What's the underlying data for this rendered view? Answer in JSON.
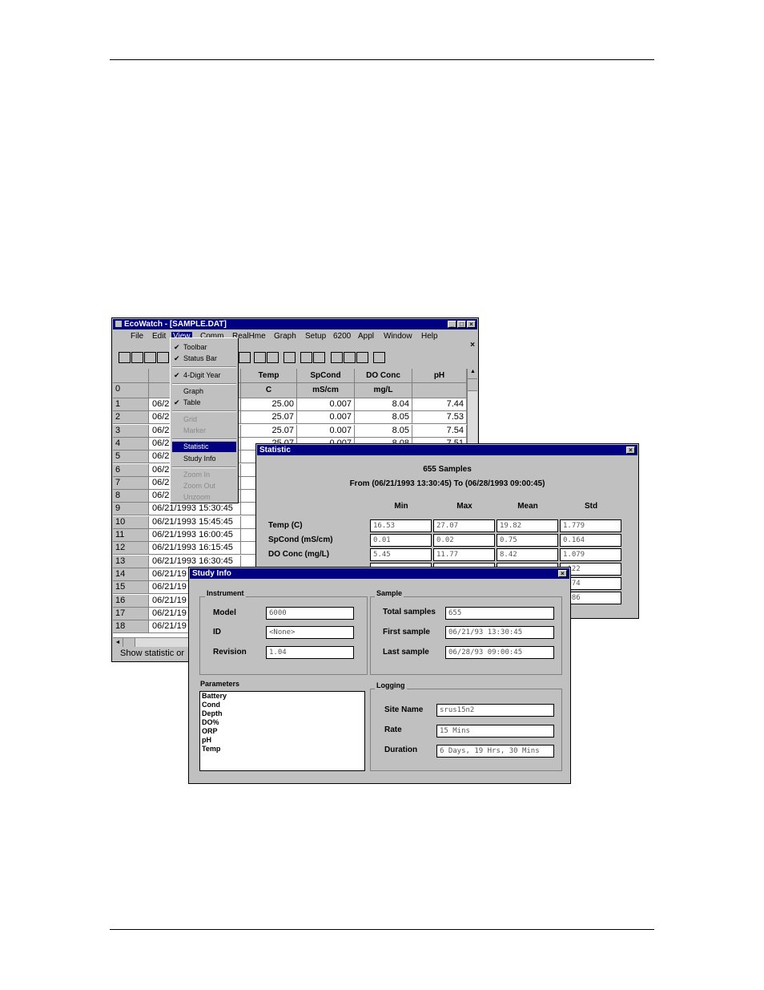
{
  "main_window": {
    "title": "EcoWatch - [SAMPLE.DAT]",
    "menu": [
      "File",
      "Edit",
      "View",
      "Comm",
      "RealHme",
      "Graph",
      "Setup",
      "6200",
      "Appl",
      "Window",
      "Help"
    ],
    "status": "Show statistic or",
    "columns": [
      "",
      "",
      "Temp",
      "SpCond",
      "DO Conc",
      "pH"
    ],
    "units_row": {
      "num": "0",
      "temp": "C",
      "spcond": "mS/cm",
      "do": "mg/L"
    },
    "rows": [
      {
        "num": "1",
        "date": "06/2",
        "temp": "25.00",
        "spcond": "0.007",
        "do": "8.04",
        "ph": "7.44"
      },
      {
        "num": "2",
        "date": "06/2",
        "temp": "25.07",
        "spcond": "0.007",
        "do": "8.05",
        "ph": "7.53"
      },
      {
        "num": "3",
        "date": "06/2",
        "temp": "25.07",
        "spcond": "0.007",
        "do": "8.05",
        "ph": "7.54"
      },
      {
        "num": "4",
        "date": "06/2",
        "temp": "25.07",
        "spcond": "0.007",
        "do": "8.08",
        "ph": "7.51"
      },
      {
        "num": "5",
        "date": "06/2"
      },
      {
        "num": "6",
        "date": "06/2"
      },
      {
        "num": "7",
        "date": "06/2"
      },
      {
        "num": "8",
        "date": "06/2"
      },
      {
        "num": "9",
        "date": "06/21/1993 15:30:45"
      },
      {
        "num": "10",
        "date": "06/21/1993 15:45:45"
      },
      {
        "num": "11",
        "date": "06/21/1993 16:00:45"
      },
      {
        "num": "12",
        "date": "06/21/1993 16:15:45"
      },
      {
        "num": "13",
        "date": "06/21/1993 16:30:45"
      },
      {
        "num": "14",
        "date": "06/21/19"
      },
      {
        "num": "15",
        "date": "06/21/19"
      },
      {
        "num": "16",
        "date": "06/21/19"
      },
      {
        "num": "17",
        "date": "06/21/19"
      },
      {
        "num": "18",
        "date": "06/21/19"
      }
    ]
  },
  "view_menu": {
    "items": [
      {
        "label": "Toolbar",
        "checked": true,
        "enabled": true
      },
      {
        "label": "Status Bar",
        "checked": true,
        "enabled": true
      },
      {
        "label": "4-Digit Year",
        "checked": true,
        "enabled": true
      },
      {
        "label": "Graph",
        "checked": false,
        "enabled": true
      },
      {
        "label": "Table",
        "checked": true,
        "enabled": true
      },
      {
        "label": "Grid",
        "checked": false,
        "enabled": false
      },
      {
        "label": "Marker",
        "checked": false,
        "enabled": false
      },
      {
        "label": "Statistic",
        "checked": false,
        "enabled": true,
        "highlighted": true
      },
      {
        "label": "Study Info",
        "checked": false,
        "enabled": true
      },
      {
        "label": "Zoom In",
        "checked": false,
        "enabled": false
      },
      {
        "label": "Zoom Out",
        "checked": false,
        "enabled": false
      },
      {
        "label": "Unzoom",
        "checked": false,
        "enabled": false
      }
    ]
  },
  "statistic": {
    "title": "Statistic",
    "samples": "655 Samples",
    "range": "From (06/21/1993 13:30:45) To (06/28/1993 09:00:45)",
    "headers": [
      "Min",
      "Max",
      "Mean",
      "Std"
    ],
    "rows": [
      {
        "label": "Temp (C)",
        "values": [
          "16.53",
          "27.07",
          "19.82",
          "1.779"
        ]
      },
      {
        "label": "SpCond (mS/cm)",
        "values": [
          "0.01",
          "0.02",
          "0.75",
          "0.164"
        ]
      },
      {
        "label": "DO Conc (mg/L)",
        "values": [
          "5.45",
          "11.77",
          "8.42",
          "1.079"
        ]
      },
      {
        "label": "",
        "values": [
          "",
          "",
          "",
          ".122"
        ]
      },
      {
        "label": "",
        "values": [
          "",
          "",
          "",
          ".074"
        ]
      },
      {
        "label": "",
        "values": [
          "",
          "",
          "",
          ".086"
        ]
      }
    ]
  },
  "study_info": {
    "title": "Study Info",
    "instrument_label": "Instrument",
    "model_label": "Model",
    "model": "6000",
    "id_label": "ID",
    "id": "<None>",
    "revision_label": "Revision",
    "revision": "1.04",
    "sample_label": "Sample",
    "total_label": "Total samples",
    "total": "655",
    "first_label": "First sample",
    "first": "06/21/93 13:30:45",
    "last_label": "Last sample",
    "last": "06/28/93 09:00:45",
    "parameters_label": "Parameters",
    "parameters": [
      "Battery",
      "Cond",
      "Depth",
      "DO%",
      "ORP",
      "pH",
      "Temp"
    ],
    "logging_label": "Logging",
    "site_label": "Site Name",
    "site": "srus15n2",
    "rate_label": "Rate",
    "rate": "15 Mins",
    "duration_label": "Duration",
    "duration": "6 Days, 19 Hrs, 30 Mins"
  }
}
